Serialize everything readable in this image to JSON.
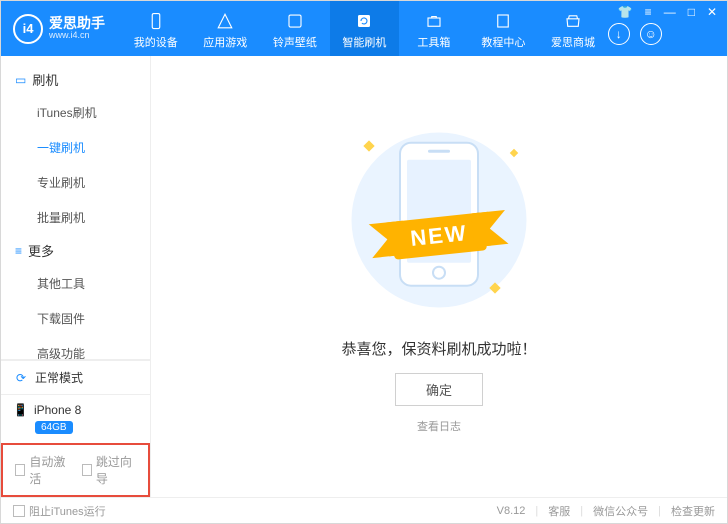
{
  "app": {
    "logo_abbr": "i4",
    "title": "爱思助手",
    "subtitle": "www.i4.cn"
  },
  "top_tabs": [
    {
      "key": "device",
      "label": "我的设备"
    },
    {
      "key": "apps",
      "label": "应用游戏"
    },
    {
      "key": "tones",
      "label": "铃声壁纸"
    },
    {
      "key": "flash",
      "label": "智能刷机",
      "active": true
    },
    {
      "key": "toolbox",
      "label": "工具箱"
    },
    {
      "key": "tutorial",
      "label": "教程中心"
    },
    {
      "key": "store",
      "label": "爱思商城"
    }
  ],
  "sidebar": {
    "section1": {
      "title": "刷机",
      "items": [
        {
          "label": "iTunes刷机"
        },
        {
          "label": "一键刷机",
          "active": true
        },
        {
          "label": "专业刷机"
        },
        {
          "label": "批量刷机"
        }
      ]
    },
    "section2": {
      "title": "更多",
      "items": [
        {
          "label": "其他工具"
        },
        {
          "label": "下载固件"
        },
        {
          "label": "高级功能"
        }
      ]
    },
    "mode": "正常模式",
    "device_model": "iPhone 8",
    "device_storage": "64GB",
    "checkboxes": {
      "auto_activate": "自动激活",
      "skip_wizard": "跳过向导"
    }
  },
  "main": {
    "ribbon": "NEW",
    "headline": "恭喜您，保资料刷机成功啦！",
    "ok_label": "确定",
    "log_link": "查看日志"
  },
  "footer": {
    "prevent_itunes": "阻止iTunes运行",
    "version": "V8.12",
    "support": "客服",
    "wechat": "微信公众号",
    "update": "检查更新"
  }
}
